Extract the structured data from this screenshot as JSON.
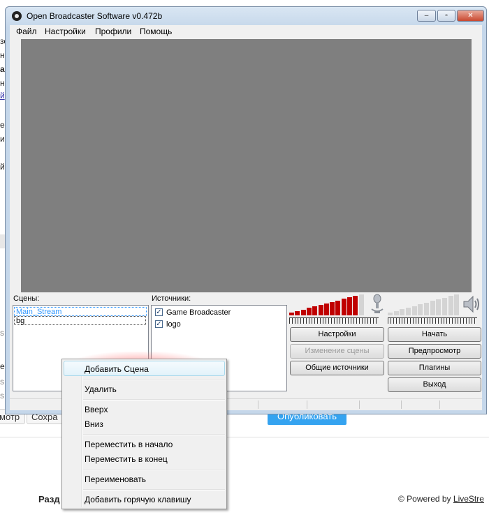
{
  "background_page": {
    "left_fragments": [
      "зс",
      "на",
      "а",
      "н",
      "й",
      "ен",
      "и",
      "й",
      "s",
      "е",
      "s",
      "s",
      "е"
    ],
    "buttons": [
      "мотр",
      "Сохра"
    ],
    "publish_button": "Опубликовать",
    "section_heading": "Разд",
    "powered_prefix": "© Powered by",
    "powered_link": "LiveStre"
  },
  "window": {
    "title": "Open Broadcaster Software v0.472b",
    "controls": {
      "minimize": "–",
      "maximize": "▫",
      "close": "✕"
    }
  },
  "menu": [
    "Файл",
    "Настройки",
    "Профили",
    "Помощь"
  ],
  "scenes": {
    "label": "Сцены:",
    "items": [
      "Main_Stream",
      "bg"
    ]
  },
  "sources": {
    "label": "Источники:",
    "items": [
      {
        "name": "Game Broadcaster",
        "checked": true
      },
      {
        "name": "logo",
        "checked": true
      }
    ]
  },
  "meters": {
    "mic_level": 0.9,
    "desktop_level": 0.0,
    "mic_color": "#c00000",
    "idle_color": "#d4d4d4"
  },
  "buttons": {
    "settings": "Настройки",
    "start": "Начать",
    "edit_scene": "Изменение сцены",
    "preview": "Предпросмотр",
    "global_sources": "Общие источники",
    "plugins": "Плагины",
    "exit": "Выход"
  },
  "context_menu": {
    "items": [
      "Добавить Сцена",
      "Удалить",
      "Вверх",
      "Вниз",
      "Переместить в начало",
      "Переместить в конец",
      "Переименовать",
      "Добавить горячую клавишу"
    ]
  },
  "colors": {
    "preview_bg": "#7f7f7f",
    "publish_bg": "#35a3f0",
    "selection": "#3399ff"
  }
}
